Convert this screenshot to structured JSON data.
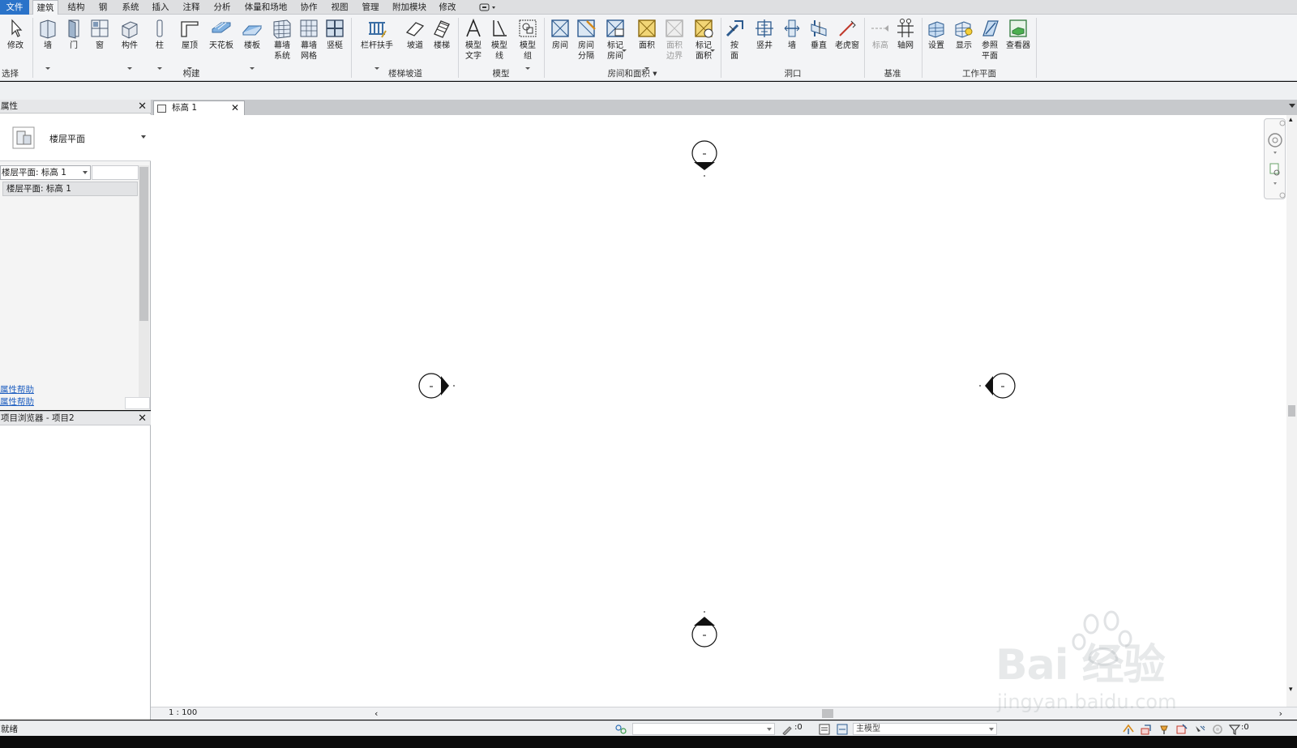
{
  "menu": {
    "tabs": [
      "文件",
      "建筑",
      "结构",
      "钢",
      "系统",
      "插入",
      "注释",
      "分析",
      "体量和场地",
      "协作",
      "视图",
      "管理",
      "附加模块",
      "修改"
    ],
    "active": "建筑"
  },
  "ribbon": {
    "modify": {
      "label": "修改",
      "group": "选择"
    },
    "build": {
      "items": [
        "墙",
        "门",
        "窗",
        "构件",
        "柱",
        "屋顶",
        "天花板",
        "楼板",
        "幕墙\n系统",
        "幕墙\n网格",
        "竖梃"
      ],
      "group": "构建"
    },
    "stairs": {
      "items": [
        "栏杆扶手",
        "坡道",
        "楼梯"
      ],
      "group": "楼梯坡道"
    },
    "model": {
      "items": [
        "模型\n文字",
        "模型\n线",
        "模型\n组"
      ],
      "group": "模型"
    },
    "room": {
      "items": [
        "房间",
        "房间\n分隔",
        "标记\n房间",
        "面积",
        "面积\n边界",
        "标记\n面积"
      ],
      "group": "房间和面积"
    },
    "opening": {
      "items": [
        "按\n面",
        "竖井",
        "墙",
        "垂直",
        "老虎窗"
      ],
      "group": "洞口"
    },
    "datum": {
      "items": [
        "标高",
        "轴网"
      ],
      "group": "基准"
    },
    "workplane": {
      "items": [
        "设置",
        "显示",
        "参照\n平面",
        "查看器"
      ],
      "group": "工作平面"
    }
  },
  "properties": {
    "title": "属性",
    "type_name": "楼层平面",
    "type_dropdown": "楼层平面: 标高 1",
    "type_row": "楼层平面: 标高 1",
    "help1": "属性帮助",
    "help2": "属性帮助"
  },
  "browser": {
    "title": "项目浏览器 - 项目2"
  },
  "view": {
    "tab": "标高 1",
    "scale": "1 : 100"
  },
  "status": {
    "text": "就绪",
    "count1": ":0",
    "model": "主模型",
    "count2": ":0"
  },
  "watermark": {
    "brand": "Bai 经验",
    "url": "jingyan.baidu.com"
  }
}
